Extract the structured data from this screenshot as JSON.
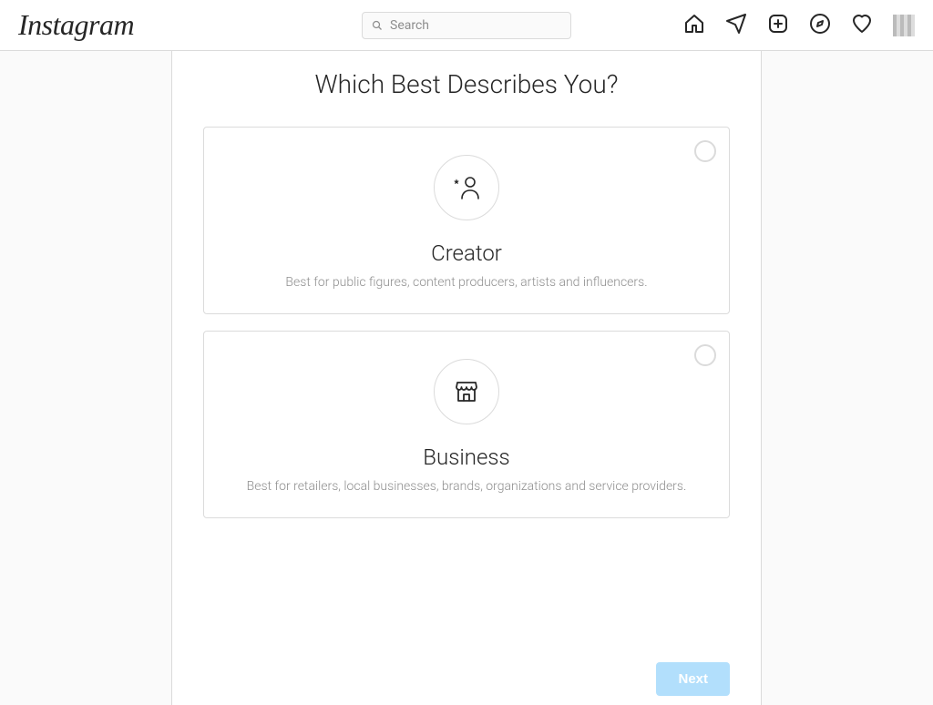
{
  "brand": "Instagram",
  "search": {
    "placeholder": "Search"
  },
  "page": {
    "heading": "Which Best Describes You?",
    "options": {
      "creator": {
        "title": "Creator",
        "desc": "Best for public figures, content producers, artists and influencers."
      },
      "business": {
        "title": "Business",
        "desc": "Best for retailers, local businesses, brands, organizations and service providers."
      }
    },
    "next_label": "Next"
  }
}
